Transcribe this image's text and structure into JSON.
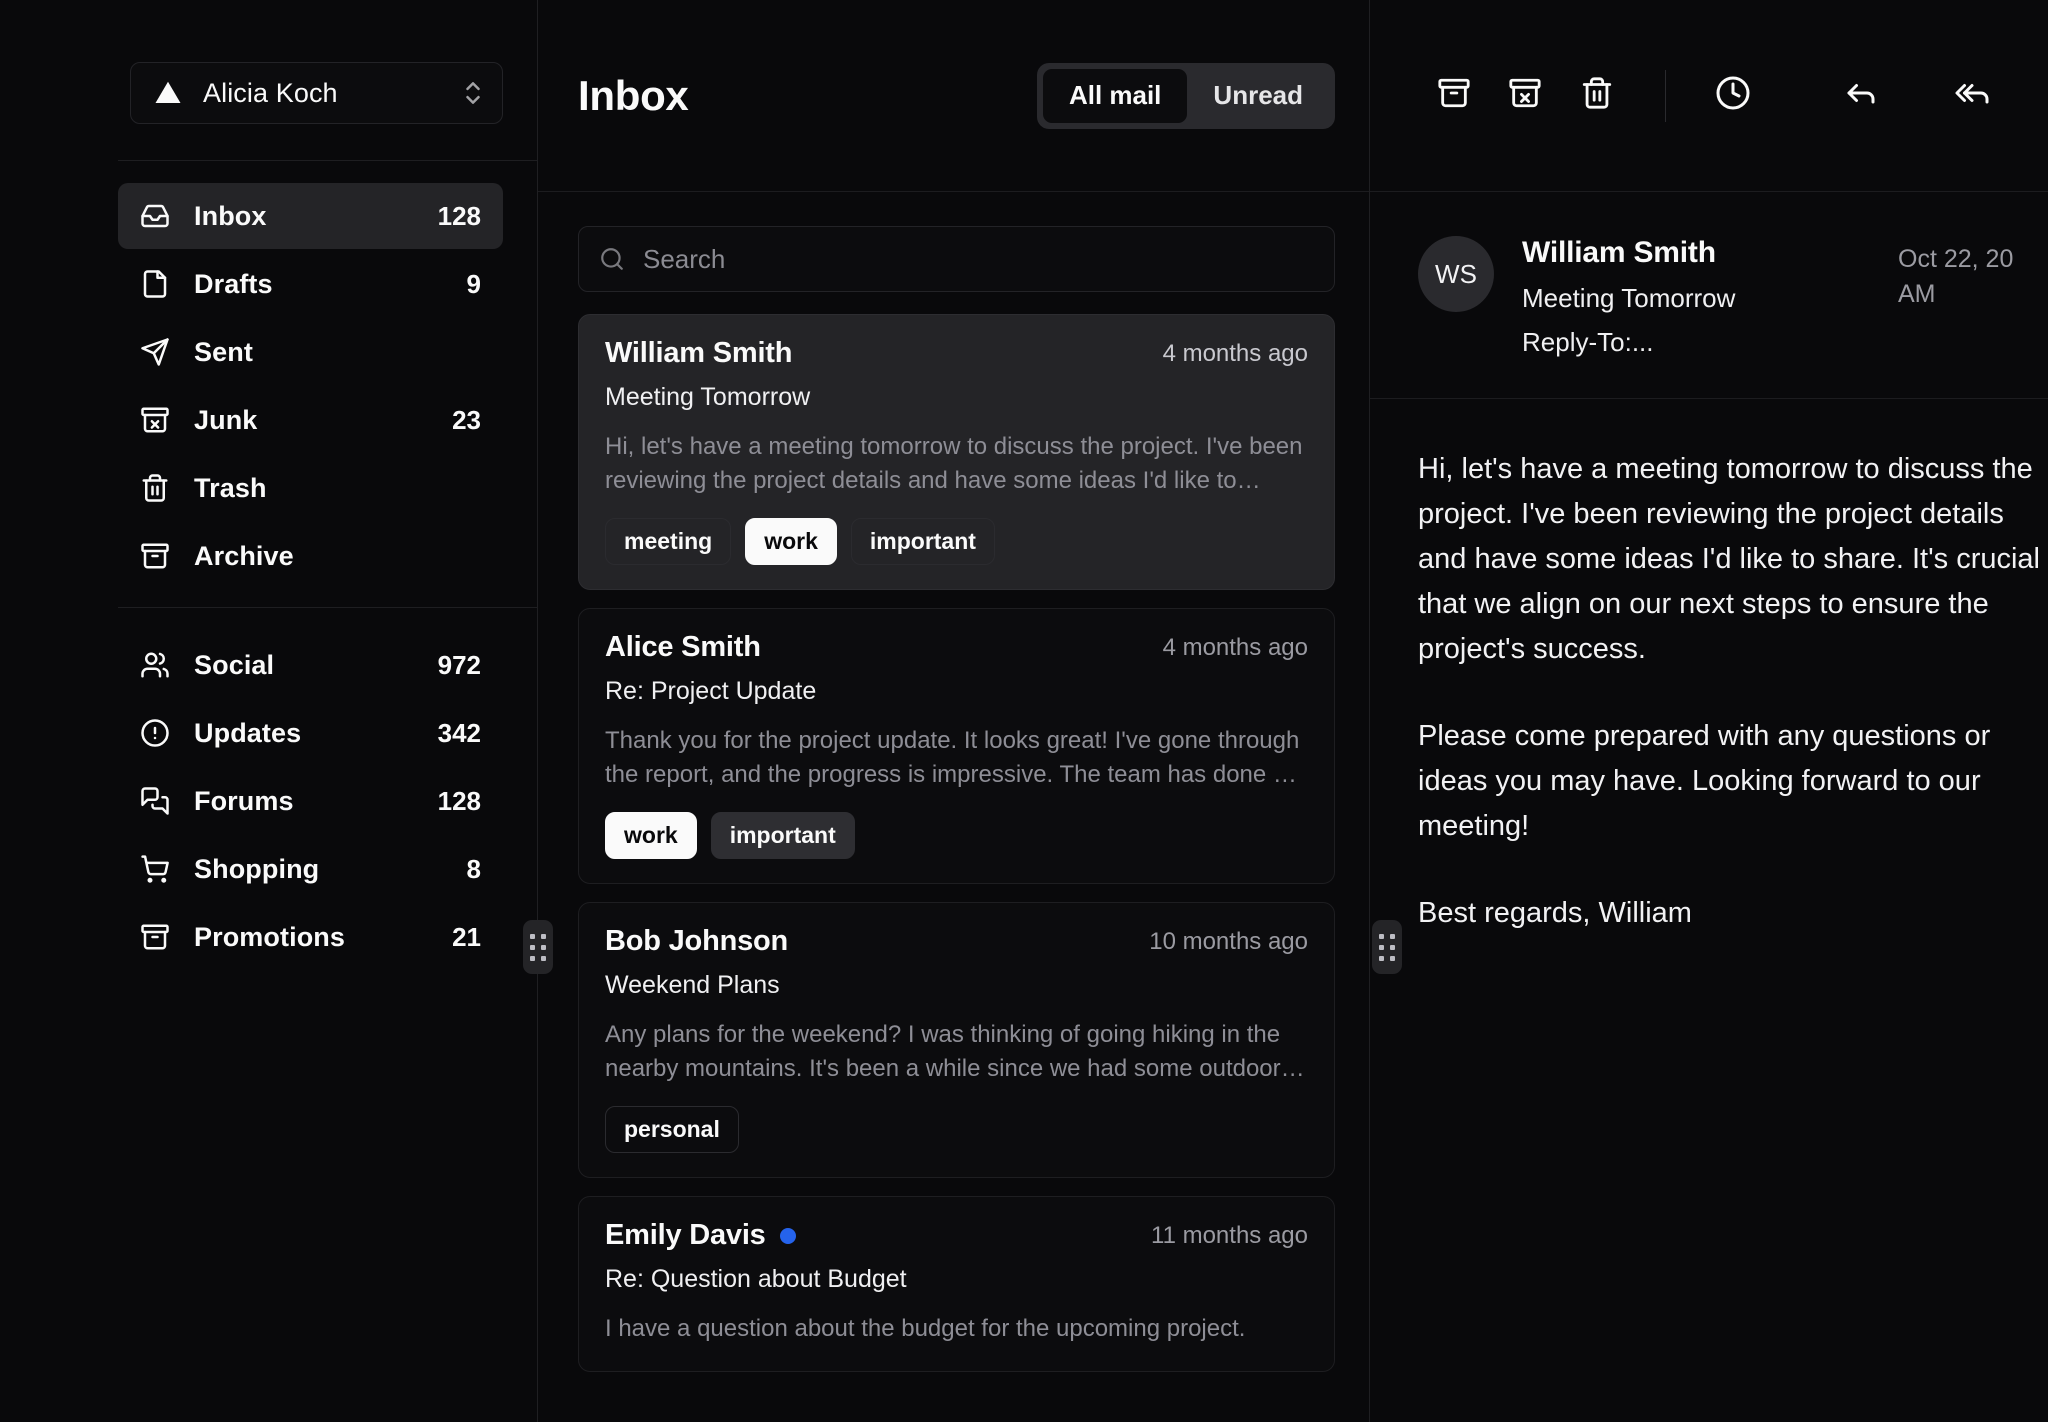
{
  "account": {
    "name": "Alicia Koch",
    "logo_icon": "triangle-logo-icon",
    "switcher_icon": "chevrons-up-down-icon"
  },
  "sidebar": {
    "primary_items": [
      {
        "label": "Inbox",
        "count": "128",
        "icon": "inbox-icon",
        "active": true
      },
      {
        "label": "Drafts",
        "count": "9",
        "icon": "file-icon",
        "active": false
      },
      {
        "label": "Sent",
        "count": "",
        "icon": "send-icon",
        "active": false
      },
      {
        "label": "Junk",
        "count": "23",
        "icon": "archive-x-icon",
        "active": false
      },
      {
        "label": "Trash",
        "count": "",
        "icon": "trash-icon",
        "active": false
      },
      {
        "label": "Archive",
        "count": "",
        "icon": "archive-icon",
        "active": false
      }
    ],
    "secondary_items": [
      {
        "label": "Social",
        "count": "972",
        "icon": "users-icon"
      },
      {
        "label": "Updates",
        "count": "342",
        "icon": "alert-circle-icon"
      },
      {
        "label": "Forums",
        "count": "128",
        "icon": "message-square-icon"
      },
      {
        "label": "Shopping",
        "count": "8",
        "icon": "shopping-cart-icon"
      },
      {
        "label": "Promotions",
        "count": "21",
        "icon": "archive-icon"
      }
    ]
  },
  "list": {
    "title": "Inbox",
    "tabs": [
      {
        "label": "All mail",
        "active": true
      },
      {
        "label": "Unread",
        "active": false
      }
    ],
    "search": {
      "placeholder": "Search",
      "value": "",
      "icon": "search-icon"
    },
    "emails": [
      {
        "sender": "William Smith",
        "time": "4 months ago",
        "subject": "Meeting Tomorrow",
        "preview": "Hi, let's have a meeting tomorrow to discuss the project. I've been reviewing the project details and have some ideas I'd like to share. It's crucial that we align on our next steps.",
        "tags": [
          {
            "label": "meeting",
            "style": "outline"
          },
          {
            "label": "work",
            "style": "solid"
          },
          {
            "label": "important",
            "style": "outline"
          }
        ],
        "unread": false,
        "selected": true
      },
      {
        "sender": "Alice Smith",
        "time": "4 months ago",
        "subject": "Re: Project Update",
        "preview": "Thank you for the project update. It looks great! I've gone through the report, and the progress is impressive. The team has done a fantastic job.",
        "tags": [
          {
            "label": "work",
            "style": "solid"
          },
          {
            "label": "important",
            "style": "muted"
          }
        ],
        "unread": false,
        "selected": false
      },
      {
        "sender": "Bob Johnson",
        "time": "10 months ago",
        "subject": "Weekend Plans",
        "preview": "Any plans for the weekend? I was thinking of going hiking in the nearby mountains. It's been a while since we had some outdoor fun.",
        "tags": [
          {
            "label": "personal",
            "style": "outline"
          }
        ],
        "unread": false,
        "selected": false
      },
      {
        "sender": "Emily Davis",
        "time": "11 months ago",
        "subject": "Re: Question about Budget",
        "preview": "I have a question about the budget for the upcoming project.",
        "tags": [],
        "unread": true,
        "selected": false
      }
    ]
  },
  "reader": {
    "toolbar": [
      {
        "name": "archive-icon",
        "label": "Archive"
      },
      {
        "name": "archive-x-icon",
        "label": "Move to junk"
      },
      {
        "name": "trash-icon",
        "label": "Move to trash"
      },
      {
        "name": "separator",
        "label": ""
      },
      {
        "name": "clock-icon",
        "label": "Snooze"
      },
      {
        "name": "reply-icon",
        "label": "Reply"
      },
      {
        "name": "reply-all-icon",
        "label": "Reply all"
      }
    ],
    "message": {
      "avatar_initials": "WS",
      "sender": "William Smith",
      "subject": "Meeting Tomorrow",
      "reply_to": "Reply-To:...",
      "date": "Oct 22, 20 AM",
      "body_paragraphs": [
        "Hi, let's have a meeting tomorrow to discuss the project. I've been reviewing the project details and have some ideas I'd like to share. It's crucial that we align on our next steps to ensure the project's success.",
        "Please come prepared with any questions or ideas you may have. Looking forward to our meeting!",
        "Best regards, William"
      ]
    }
  },
  "colors": {
    "background": "#09090b",
    "panel": "#0c0c0e",
    "selected": "#242427",
    "accent_unread": "#2563EB",
    "text": "#fafafa",
    "muted_text": "#8e8e96"
  }
}
